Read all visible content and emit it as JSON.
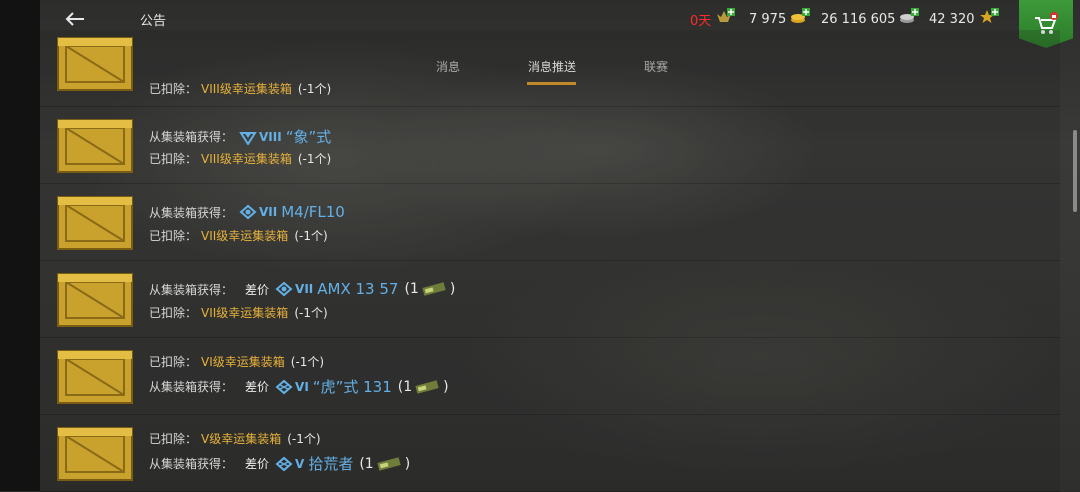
{
  "header": {
    "title": "公告",
    "premium": {
      "value": "0天",
      "icon": "premium-icon",
      "color": "#ff2a2a"
    },
    "gold": {
      "value": "7 975",
      "icon": "gold-coin-icon"
    },
    "credits": {
      "value": "26 116 605",
      "icon": "silver-coin-icon"
    },
    "free_xp": {
      "value": "42 320",
      "icon": "free-xp-star-icon"
    },
    "shop": {
      "icon": "shop-cart-icon",
      "color": "#3e9a3a"
    }
  },
  "tabs": [
    {
      "label": "消息",
      "active": false
    },
    {
      "label": "消息推送",
      "active": true
    },
    {
      "label": "联赛",
      "active": false
    }
  ],
  "accent_color": "#e6a12a",
  "rows": [
    {
      "lines": [
        {
          "label": "已扣除：",
          "item": "VIII级幸运集装箱",
          "count": "(-1个)"
        }
      ]
    },
    {
      "lines": [
        {
          "label": "从集装箱获得：",
          "tier": "VIII",
          "tank": "“象”式"
        },
        {
          "label": "已扣除：",
          "item": "VIII级幸运集装箱",
          "count": "(-1个)"
        }
      ]
    },
    {
      "lines": [
        {
          "label": "从集装箱获得：",
          "tier": "VII",
          "tank": "M4/FL10"
        },
        {
          "label": "已扣除：",
          "item": "VII级幸运集装箱",
          "count": "(-1个)"
        }
      ]
    },
    {
      "lines": [
        {
          "label": "从集装箱获得：",
          "diff": "差价",
          "tier": "VII",
          "tank": "AMX 13 57",
          "qty_open": "(1",
          "qty_close": ")"
        },
        {
          "label": "已扣除：",
          "item": "VII级幸运集装箱",
          "count": "(-1个)"
        }
      ]
    },
    {
      "lines": [
        {
          "label": "已扣除：",
          "item": "VI级幸运集装箱",
          "count": "(-1个)"
        },
        {
          "label": "从集装箱获得：",
          "diff": "差价",
          "tier": "VI",
          "tank": "“虎”式 131",
          "qty_open": "(1",
          "qty_close": ")"
        }
      ]
    },
    {
      "lines": [
        {
          "label": "已扣除：",
          "item": "V级幸运集装箱",
          "count": "(-1个)"
        },
        {
          "label": "从集装箱获得：",
          "diff": "差价",
          "tier": "V",
          "tank": "拾荒者",
          "qty_open": "(1",
          "qty_close": ")"
        }
      ]
    }
  ]
}
